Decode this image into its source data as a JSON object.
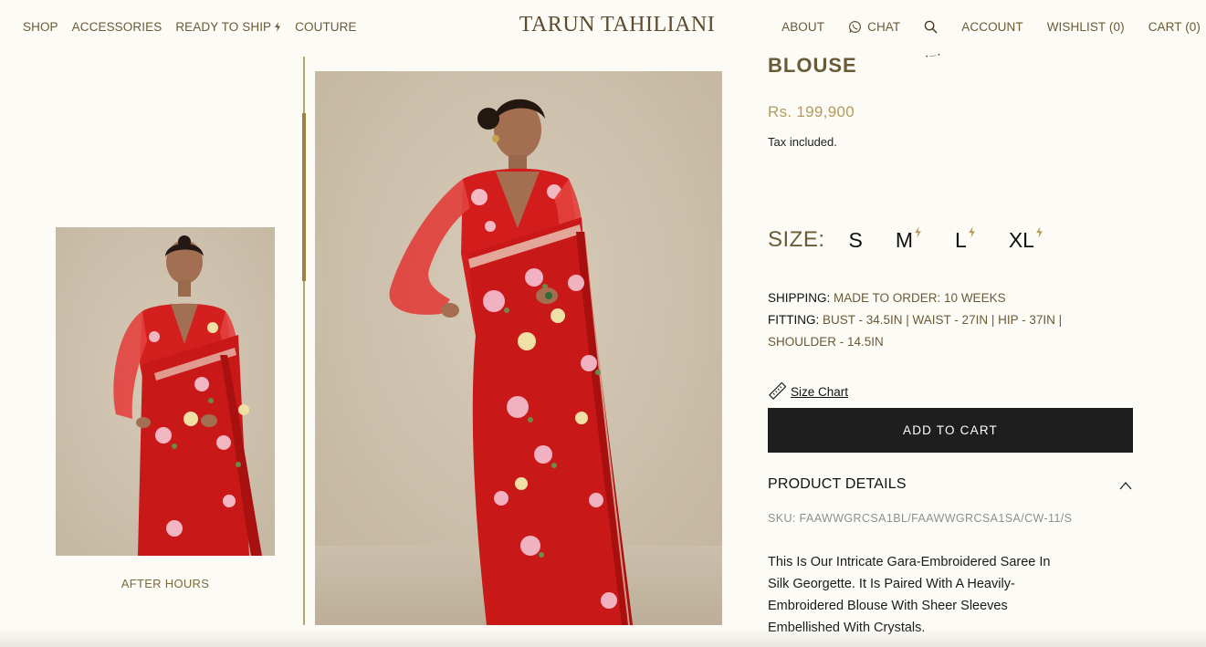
{
  "header": {
    "nav_left": [
      {
        "label": "SHOP"
      },
      {
        "label": "ACCESSORIES"
      },
      {
        "label": "READY TO SHIP",
        "icon": "bolt-icon"
      },
      {
        "label": "COUTURE"
      }
    ],
    "logo": "TARUN TAHILIANI",
    "nav_right": {
      "about": "ABOUT",
      "chat": "CHAT",
      "chat_icon": "whatsapp-icon",
      "search_icon": "search-icon",
      "account": "ACCOUNT",
      "wishlist": "WISHLIST (0)",
      "cart": "CART (0)"
    }
  },
  "gallery": {
    "thumb_caption": "AFTER HOURS"
  },
  "product": {
    "title": "BLOUSE",
    "price": "Rs. 199,900",
    "tax_note": "Tax included.",
    "size_label": "SIZE:",
    "sizes": [
      {
        "label": "S",
        "ready_to_ship": false
      },
      {
        "label": "M",
        "ready_to_ship": true
      },
      {
        "label": "L",
        "ready_to_ship": true
      },
      {
        "label": "XL",
        "ready_to_ship": true
      }
    ],
    "shipping_key": "SHIPPING:",
    "shipping_value": "MADE TO ORDER: 10 WEEKS",
    "fitting_key": "FITTING:",
    "fitting_value": "BUST - 34.5IN | WAIST - 27IN | HIP - 37IN | SHOULDER - 14.5IN",
    "size_chart_label": "Size Chart",
    "add_to_cart": "ADD TO CART",
    "details_heading": "PRODUCT DETAILS",
    "sku": "SKU: FAAWWGRCSA1BL/FAAWWGRCSA1SA/CW-11/S",
    "description": "This Is Our Intricate Gara-Embroidered Saree In Silk Georgette. It Is Paired With A Heavily-Embroidered Blouse With Sheer Sleeves Embellished With Crystals."
  },
  "colors": {
    "brand_gold": "#6b5a36",
    "price_gold": "#b59a5e",
    "background": "#fcfbf6",
    "button": "#1e1e1e"
  }
}
